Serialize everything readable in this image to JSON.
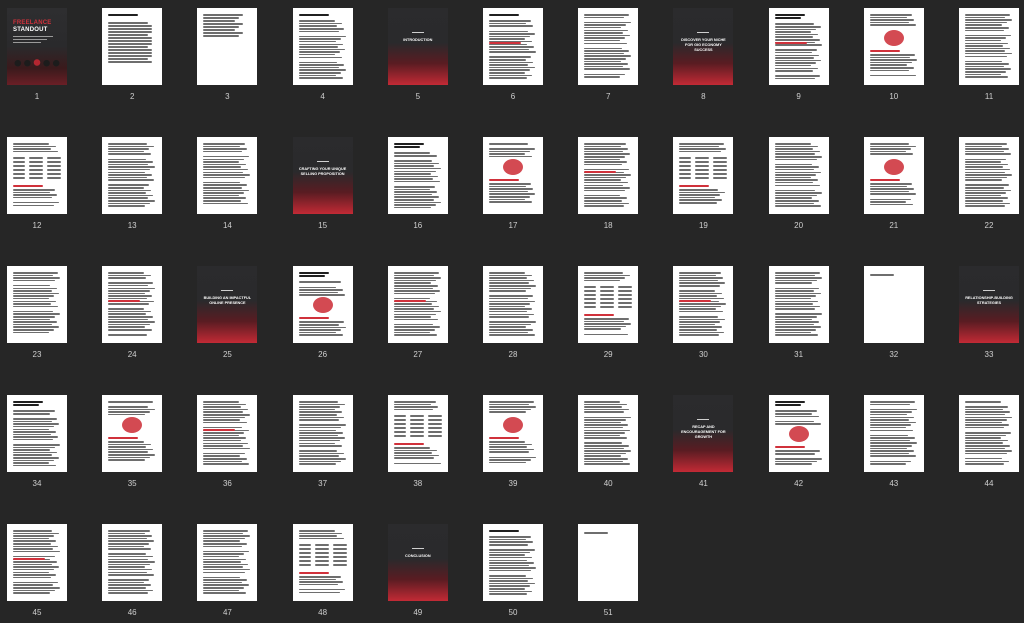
{
  "cover": {
    "title_line1": "FREELANCE",
    "title_line2": "STANDOUT"
  },
  "pages": [
    {
      "num": "1",
      "type": "cover"
    },
    {
      "num": "2",
      "type": "toc",
      "title": "TABLE OF CONTENTS"
    },
    {
      "num": "3",
      "type": "toc2"
    },
    {
      "num": "4",
      "type": "text",
      "title": "DISCLAIMER"
    },
    {
      "num": "5",
      "type": "divider",
      "title": "INTRODUCTION"
    },
    {
      "num": "6",
      "type": "text",
      "title": "INTRODUCTION"
    },
    {
      "num": "7",
      "type": "text"
    },
    {
      "num": "8",
      "type": "divider",
      "title": "DISCOVER YOUR NICHE FOR GIG ECONOMY SUCCESS"
    },
    {
      "num": "9",
      "type": "text",
      "title": "DISCOVER YOUR NICHE FOR GIG ECONOMY SUCCESS"
    },
    {
      "num": "10",
      "type": "figure"
    },
    {
      "num": "11",
      "type": "text"
    },
    {
      "num": "12",
      "type": "table"
    },
    {
      "num": "13",
      "type": "text"
    },
    {
      "num": "14",
      "type": "text"
    },
    {
      "num": "15",
      "type": "divider",
      "title": "CRAFTING YOUR UNIQUE SELLING PROPOSITION"
    },
    {
      "num": "16",
      "type": "text",
      "title": "CRAFTING YOUR UNIQUE SELLING PROPOSITION"
    },
    {
      "num": "17",
      "type": "figure"
    },
    {
      "num": "18",
      "type": "text"
    },
    {
      "num": "19",
      "type": "table"
    },
    {
      "num": "20",
      "type": "text"
    },
    {
      "num": "21",
      "type": "figure"
    },
    {
      "num": "22",
      "type": "text"
    },
    {
      "num": "23",
      "type": "text"
    },
    {
      "num": "24",
      "type": "text"
    },
    {
      "num": "25",
      "type": "divider",
      "title": "BUILDING AN IMPACTFUL ONLINE PRESENCE"
    },
    {
      "num": "26",
      "type": "figure",
      "title": "BUILDING AN IMPACTFUL ONLINE PRESENCE"
    },
    {
      "num": "27",
      "type": "text"
    },
    {
      "num": "28",
      "type": "text"
    },
    {
      "num": "29",
      "type": "table"
    },
    {
      "num": "30",
      "type": "text"
    },
    {
      "num": "31",
      "type": "text"
    },
    {
      "num": "32",
      "type": "sparse"
    },
    {
      "num": "33",
      "type": "divider",
      "title": "RELATIONSHIP-BUILDING STRATEGIES"
    },
    {
      "num": "34",
      "type": "text",
      "title": "RELATIONSHIP-BUILDING STRATEGIES"
    },
    {
      "num": "35",
      "type": "figure"
    },
    {
      "num": "36",
      "type": "text"
    },
    {
      "num": "37",
      "type": "text"
    },
    {
      "num": "38",
      "type": "table"
    },
    {
      "num": "39",
      "type": "figure"
    },
    {
      "num": "40",
      "type": "text"
    },
    {
      "num": "41",
      "type": "divider",
      "title": "RECAP AND ENCOURAGEMENT FOR GROWTH"
    },
    {
      "num": "42",
      "type": "figure",
      "title": "RECAP AND ENCOURAGEMENT FOR GROWTH"
    },
    {
      "num": "43",
      "type": "text"
    },
    {
      "num": "44",
      "type": "text"
    },
    {
      "num": "45",
      "type": "text"
    },
    {
      "num": "46",
      "type": "text"
    },
    {
      "num": "47",
      "type": "text"
    },
    {
      "num": "48",
      "type": "table"
    },
    {
      "num": "49",
      "type": "divider",
      "title": "CONCLUSION"
    },
    {
      "num": "50",
      "type": "text",
      "title": "CONCLUSION"
    },
    {
      "num": "51",
      "type": "sparse"
    }
  ]
}
